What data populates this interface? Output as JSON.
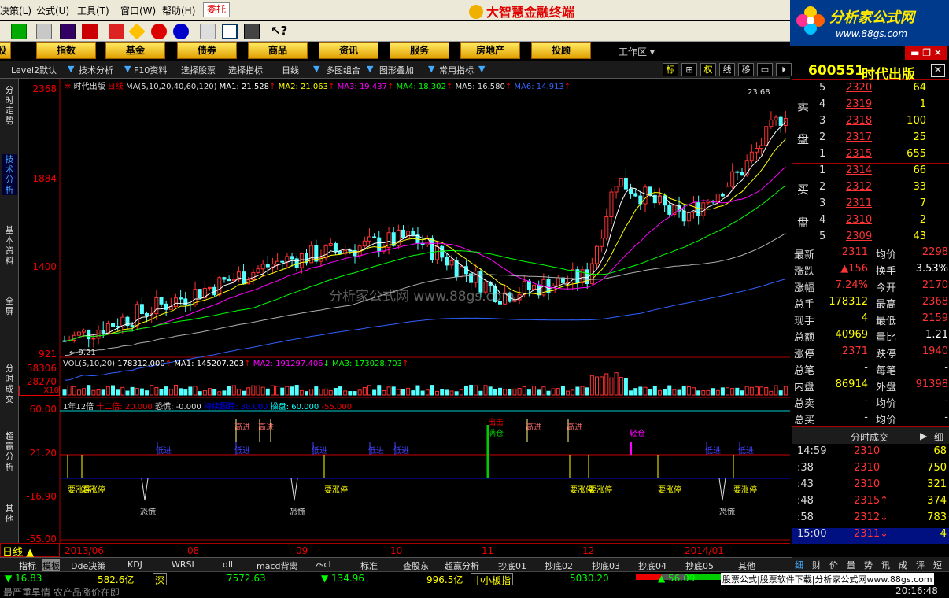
{
  "menu": {
    "items": [
      "决策(L)",
      "公式(U)",
      "工具(T)",
      "窗口(W)",
      "帮助(H)"
    ],
    "weituo": "委托",
    "app_title": "大智慧金融终端"
  },
  "logo": {
    "title": "分析家公式网",
    "url": "www.88gs.com"
  },
  "categories": [
    "股",
    "指数",
    "基金",
    "债券",
    "商品",
    "资讯",
    "服务",
    "房地产",
    "投顾"
  ],
  "workarea": "工作区",
  "tabs": [
    "Level2默认",
    "技术分析",
    "F10资料",
    "选择股票",
    "选择指标",
    "日线",
    "多图组合",
    "图形叠加",
    "常用指标"
  ],
  "tab_right": [
    "标",
    "⊞",
    "权",
    "线",
    "移",
    "▭",
    "⏵"
  ],
  "sidebar": [
    "分时走势",
    "技术分析",
    "基本资料",
    "全屏",
    "分时成交",
    "超赢分析",
    "其他"
  ],
  "chart_header": {
    "name": "时代出版",
    "period": "日线",
    "ma_label": "MA(5,10,20,40,60,120)",
    "ma1": "MA1: 21.528",
    "ma2": "MA2: 21.063",
    "ma3": "MA3: 19.437",
    "ma4": "MA4: 18.302",
    "ma5": "MA5: 16.580",
    "ma6": "MA6: 14.913"
  },
  "price_axis": [
    "2368",
    "1884",
    "1400",
    "921"
  ],
  "price_marks": {
    "high": "23.68",
    "low": "9.21"
  },
  "vol_header": {
    "label": "VOL(5,10,20)",
    "value": "178312.000",
    "ma1": "MA1: 145207.203",
    "ma2": "MA2: 191297.406",
    "ma3": "MA3: 173028.703"
  },
  "vol_axis": [
    "58306",
    "28270",
    "X10"
  ],
  "ind_header": {
    "a": "1年12倍",
    "b": "十二倍: 20.000",
    "c": "恐慌: -0.000",
    "d": "持续跟踪: 30.000",
    "e": "操盘: 60.000",
    "f": "-55.000"
  },
  "ind_axis": [
    "60.00",
    "21.20",
    "-16.90",
    "-55.00"
  ],
  "ind_labels": {
    "gao": "高进",
    "di": "低进",
    "zt": "要涨停",
    "kh": "恐慌",
    "cj": "出击",
    "mc": "满仓",
    "qc": "轻仓"
  },
  "date_axis": [
    "2013/06",
    "08",
    "09",
    "10",
    "11",
    "12",
    "2014/01"
  ],
  "watermark": "分析家公式网 www.88gs.com",
  "period_label": "日线",
  "stock": {
    "code": "600551",
    "name": "时代出版"
  },
  "sell": [
    {
      "lv": "5",
      "p": "2320",
      "v": "64"
    },
    {
      "lv": "4",
      "p": "2319",
      "v": "1"
    },
    {
      "lv": "3",
      "p": "2318",
      "v": "100"
    },
    {
      "lv": "2",
      "p": "2317",
      "v": "25"
    },
    {
      "lv": "1",
      "p": "2315",
      "v": "655"
    }
  ],
  "buy": [
    {
      "lv": "1",
      "p": "2314",
      "v": "66"
    },
    {
      "lv": "2",
      "p": "2312",
      "v": "33"
    },
    {
      "lv": "3",
      "p": "2311",
      "v": "7"
    },
    {
      "lv": "4",
      "p": "2310",
      "v": "2"
    },
    {
      "lv": "5",
      "p": "2309",
      "v": "43"
    }
  ],
  "sell_label": [
    "卖",
    "盘"
  ],
  "buy_label": [
    "买",
    "盘"
  ],
  "quote": [
    {
      "k1": "最新",
      "v1": "2311",
      "k2": "均价",
      "v2": "2298"
    },
    {
      "k1": "涨跌",
      "v1": "▲156",
      "k2": "换手",
      "v2": "3.53%"
    },
    {
      "k1": "涨幅",
      "v1": "7.24%",
      "k2": "今开",
      "v2": "2170"
    },
    {
      "k1": "总手",
      "v1": "178312",
      "k2": "最高",
      "v2": "2368"
    },
    {
      "k1": "现手",
      "v1": "4",
      "k2": "最低",
      "v2": "2159"
    },
    {
      "k1": "总额",
      "v1": "40969",
      "k2": "量比",
      "v2": "1.21"
    },
    {
      "k1": "涨停",
      "v1": "2371",
      "k2": "跌停",
      "v2": "1940"
    },
    {
      "k1": "总笔",
      "v1": "-",
      "k2": "每笔",
      "v2": "-"
    },
    {
      "k1": "内盘",
      "v1": "86914",
      "k2": "外盘",
      "v2": "91398"
    },
    {
      "k1": "总卖",
      "v1": "-",
      "k2": "均价",
      "v2": "-"
    },
    {
      "k1": "总买",
      "v1": "-",
      "k2": "均价",
      "v2": "-"
    }
  ],
  "ticks_header": {
    "title": "分时成交",
    "btn": "细"
  },
  "ticks": [
    {
      "t": "14:59",
      "p": "2310",
      "v": "68"
    },
    {
      "t": ":38",
      "p": "2310",
      "v": "750"
    },
    {
      "t": ":43",
      "p": "2310",
      "v": "321"
    },
    {
      "t": ":48",
      "p": "2315↑",
      "v": "374"
    },
    {
      "t": ":58",
      "p": "2312↓",
      "v": "783"
    },
    {
      "t": "15:00",
      "p": "2311↓",
      "v": "4"
    }
  ],
  "rtabs": [
    "细",
    "财",
    "价",
    "量",
    "势",
    "讯",
    "成",
    "评",
    "短"
  ],
  "bottom_tabs": [
    "指标",
    "模板",
    "Dde决策",
    "KDJ",
    "WRSI",
    "dll",
    "macd背离",
    "zscl",
    "标准",
    "查股东",
    "超赢分析",
    "抄底01",
    "抄底02",
    "抄底03",
    "抄底04",
    "抄底05",
    "其他"
  ],
  "status": {
    "s1": "▼ 16.83",
    "s2": "582.6亿",
    "s3": "深",
    "s4": "7572.63",
    "s5": "▼ 134.96",
    "s6": "996.5亿",
    "s7": "中小板指",
    "s8": "5030.20",
    "s9": "▲ 56.09",
    "s10": "股票公式|股票软件下载|分析家公式网www.88gs.com",
    "news": "最严重旱情 农产品涨价在即",
    "time": "20:16:48"
  },
  "colors": {
    "up": "#ff3232",
    "down": "#54ffff",
    "ma1": "#ffffff",
    "ma2": "#ffff00",
    "ma3": "#ff00ff",
    "ma4": "#00ff00",
    "ma5": "#b0b0b0",
    "ma6": "#3060ff"
  }
}
